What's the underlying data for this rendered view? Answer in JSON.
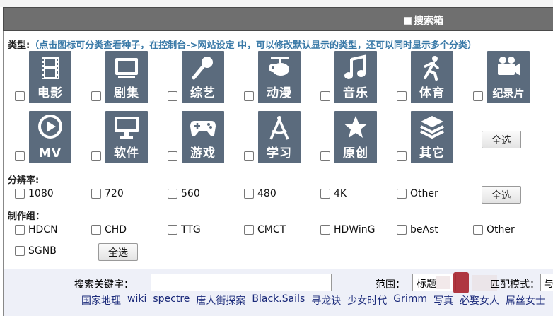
{
  "header": {
    "title": "搜索箱"
  },
  "type_section": {
    "label": "类型:",
    "hint": "（点击图标可分类查看种子，在控制台->网站设定 中，可以修改默认显示的类型，还可以同时显示多个分类）",
    "categories": [
      {
        "label": "电影",
        "icon": "film-icon"
      },
      {
        "label": "剧集",
        "icon": "tv-icon"
      },
      {
        "label": "综艺",
        "icon": "microphone-icon"
      },
      {
        "label": "动漫",
        "icon": "bird-icon"
      },
      {
        "label": "音乐",
        "icon": "music-note-icon"
      },
      {
        "label": "体育",
        "icon": "runner-icon"
      },
      {
        "label": "纪录片",
        "icon": "video-camera-icon"
      },
      {
        "label": "MV",
        "icon": "play-icon"
      },
      {
        "label": "软件",
        "icon": "monitor-icon"
      },
      {
        "label": "游戏",
        "icon": "gamepad-icon"
      },
      {
        "label": "学习",
        "icon": "compass-icon"
      },
      {
        "label": "原创",
        "icon": "star-icon"
      },
      {
        "label": "其它",
        "icon": "layers-icon"
      }
    ],
    "select_all": "全选"
  },
  "resolution_section": {
    "label": "分辨率:",
    "options": [
      "1080",
      "720",
      "560",
      "480",
      "4K",
      "Other"
    ],
    "select_all": "全选"
  },
  "group_section": {
    "label": "制作组：",
    "options": [
      "HDCN",
      "CHD",
      "TTG",
      "CMCT",
      "HDWinG",
      "beAst",
      "Other",
      "SGNB"
    ],
    "select_all": "全选"
  },
  "search": {
    "keyword_label": "搜索关键字：",
    "keyword_value": "",
    "range_label": "范围：",
    "range_value": "标题",
    "mode_label": "匹配模式：",
    "mode_value": "与",
    "hot_links": [
      "国家地理",
      "wiki",
      "spectre",
      "唐人街探案",
      "Black.Sails",
      "寻龙诀",
      "少女时代",
      "Grimm",
      "写真",
      "必娶女人",
      "屌丝女士"
    ]
  },
  "colors": {
    "header_bg": "#6f6f6f",
    "tile_bg": "#5b6b7d",
    "hint": "#3a7aa8",
    "search_bg": "#eef0f8",
    "link": "#1b2a7a"
  }
}
